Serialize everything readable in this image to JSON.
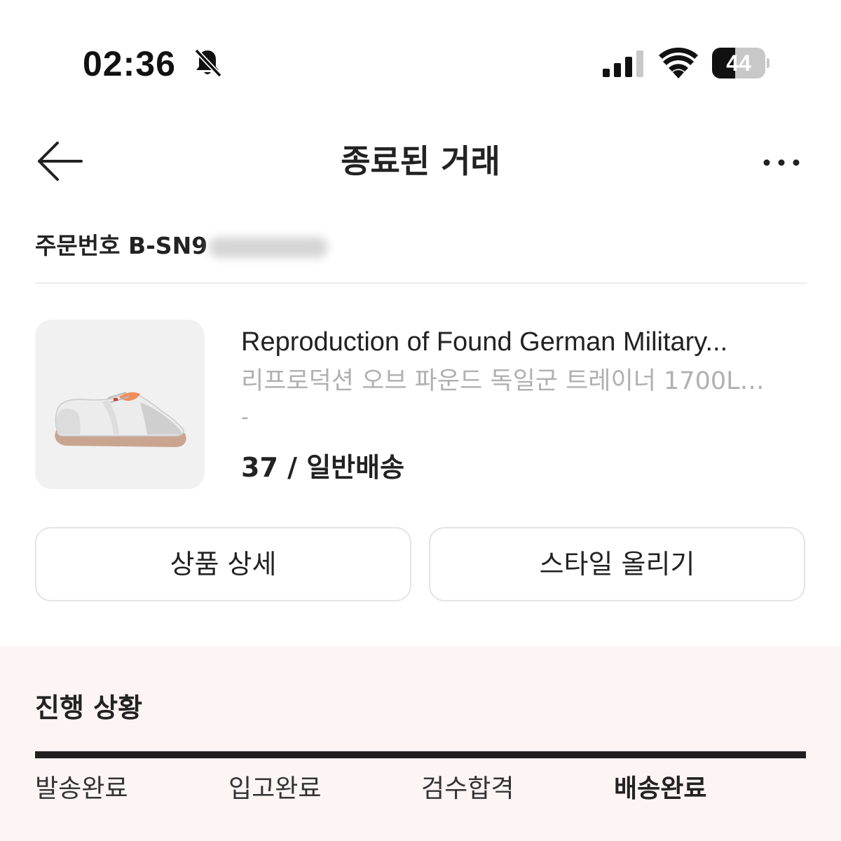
{
  "status_bar": {
    "time": "02:36",
    "battery_level": "44",
    "battery_fraction": 0.44,
    "icons": [
      "bell-slash-icon",
      "cellular-signal-icon",
      "wifi-icon",
      "battery-icon"
    ]
  },
  "header": {
    "title": "종료된 거래",
    "back_icon": "arrow-left-icon",
    "more_icon": "ellipsis-icon"
  },
  "order": {
    "label": "주문번호",
    "number_visible": "B-SN9"
  },
  "product": {
    "name": "Reproduction of Found German Military...",
    "subname": "리프로덕션 오브 파운드 독일군 트레이너 1700L…",
    "dash": "-",
    "option": "37 / 일반배송"
  },
  "actions": {
    "detail_label": "상품 상세",
    "style_label": "스타일 올리기"
  },
  "progress": {
    "title": "진행 상황",
    "completion_fraction": 1.0,
    "steps": [
      {
        "label": "발송완료",
        "active": false
      },
      {
        "label": "입고완료",
        "active": false
      },
      {
        "label": "검수합격",
        "active": false
      },
      {
        "label": "배송완료",
        "active": true
      }
    ]
  },
  "colors": {
    "accent_dark": "#231f20",
    "progress_bg": "#fdf4f4",
    "muted_text": "#b0b0b0"
  }
}
